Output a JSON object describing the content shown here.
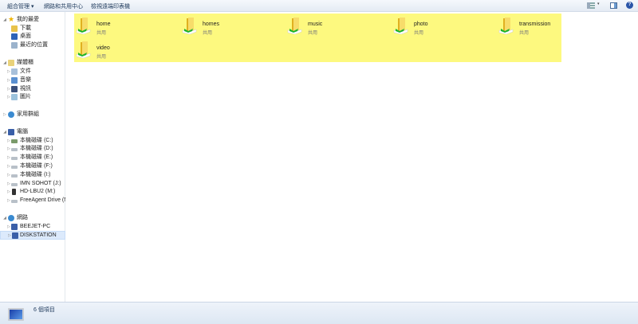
{
  "toolbar": {
    "organize": "組合管理 ▾",
    "network_center": "網路和共用中心",
    "view_printers": "檢視遠端印表機"
  },
  "sidebar": {
    "favorites": {
      "label": "我的最愛",
      "items": [
        "下載",
        "桌面",
        "最近的位置"
      ]
    },
    "libraries": {
      "label": "媒體櫃",
      "items": [
        "文件",
        "音樂",
        "視訊",
        "圖片"
      ]
    },
    "homegroup": {
      "label": "家用群組"
    },
    "computer": {
      "label": "電腦",
      "items": [
        "本機磁碟 (C:)",
        "本機磁碟 (D:)",
        "本機磁碟 (E:)",
        "本機磁碟 (F:)",
        "本機磁碟 (I:)",
        "IMN SOHOT (J:)",
        "HD-LBU2 (M:)",
        "FreeAgent Drive (N:)"
      ]
    },
    "network": {
      "label": "網路",
      "items": [
        "BEEJET-PC",
        "DISKSTATION"
      ]
    }
  },
  "items": [
    {
      "name": "home",
      "type": "共用"
    },
    {
      "name": "homes",
      "type": "共用"
    },
    {
      "name": "music",
      "type": "共用"
    },
    {
      "name": "photo",
      "type": "共用"
    },
    {
      "name": "transmission",
      "type": "共用"
    },
    {
      "name": "video",
      "type": "共用"
    }
  ],
  "status": {
    "count": "6 個項目"
  },
  "colors": {
    "highlight": "#fdf97f",
    "selected": "#dceafc"
  }
}
